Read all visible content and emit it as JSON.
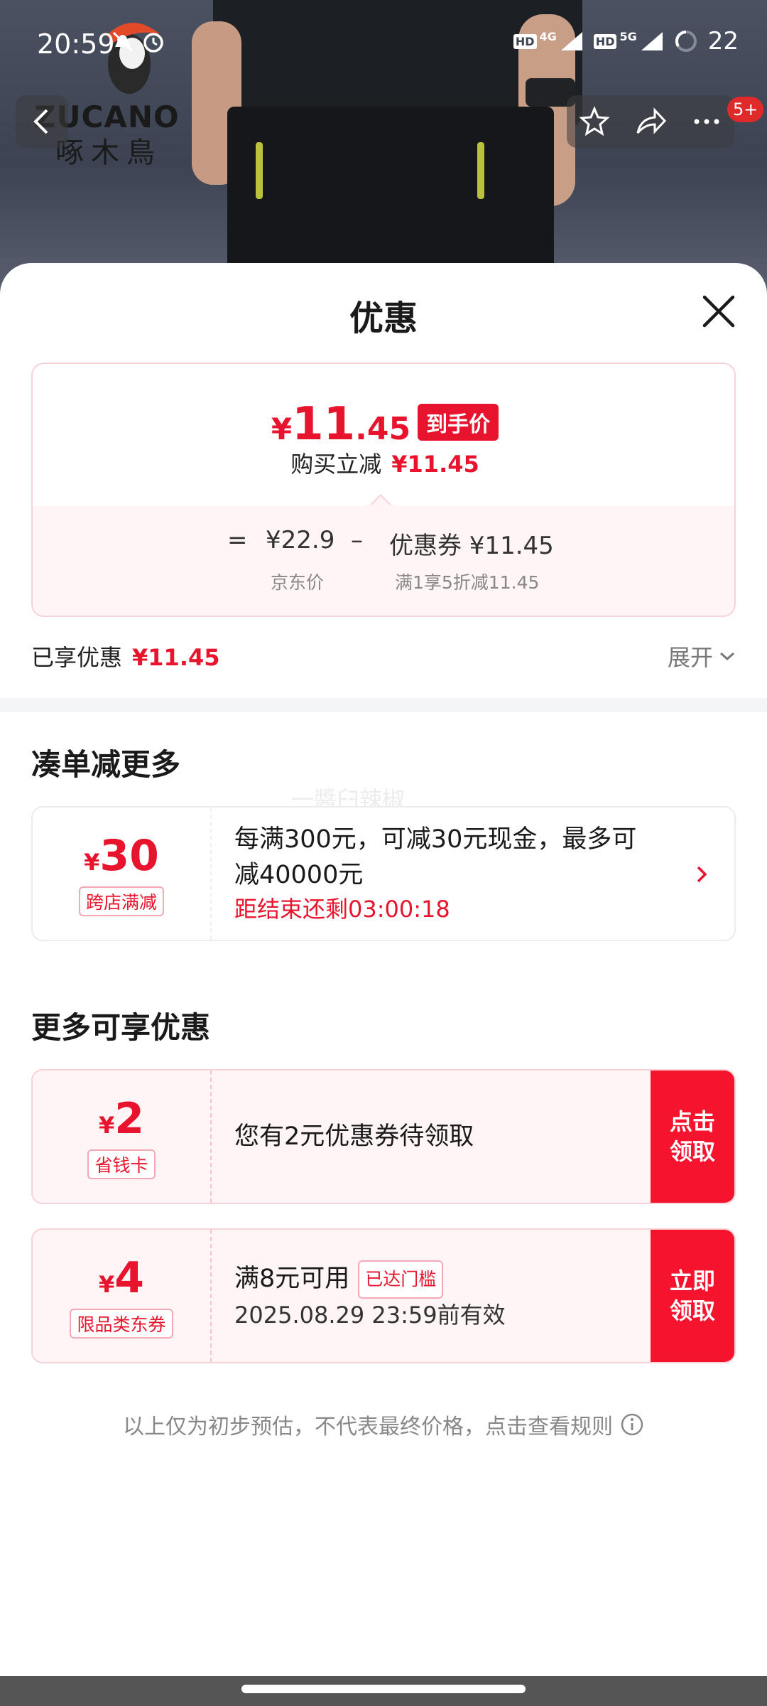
{
  "status_bar": {
    "time": "20:59",
    "network_1": "4G",
    "network_2": "5G",
    "hd_label": "HD",
    "battery": "22"
  },
  "brand": {
    "logo_text": "ZUCANO",
    "logo_cn": "啄木鳥"
  },
  "header": {
    "badge_count": "5+"
  },
  "sheet": {
    "title": "优惠"
  },
  "price_card": {
    "yen": "¥",
    "price_int": "11",
    "price_dec": ".45",
    "final_tag": "到手价",
    "reduce_label": "购买立减",
    "reduce_value": "¥11.45",
    "equals": "=",
    "jd_price": "¥22.9",
    "minus": "–",
    "coupon_label": "优惠券 ¥11.45",
    "jd_price_label": "京东价",
    "coupon_rule": "满1享5折减11.45"
  },
  "enjoyed": {
    "label": "已享优惠",
    "value": "¥11.45",
    "expand": "展开"
  },
  "section_more_order": {
    "title": "凑单减更多",
    "coupon": {
      "yen": "¥",
      "amount": "30",
      "tag": "跨店满减",
      "text_line1": "每满300元，可减30元现金，最多可",
      "text_line2": "减40000元",
      "countdown": "距结束还剩03:00:18"
    }
  },
  "section_more_discount": {
    "title": "更多可享优惠",
    "coupons": [
      {
        "yen": "¥",
        "amount": "2",
        "tag": "省钱卡",
        "text": "您有2元优惠券待领取",
        "btn_line1": "点击",
        "btn_line2": "领取"
      },
      {
        "yen": "¥",
        "amount": "4",
        "tag": "限品类东券",
        "text": "满8元可用",
        "reach_tag": "已达门槛",
        "valid": "2025.08.29 23:59前有效",
        "btn_line1": "立即",
        "btn_line2": "领取"
      }
    ]
  },
  "footer": {
    "note": "以上仅为初步预估，不代表最终价格，点击查看规则"
  },
  "watermark": "一醬臼辣椒",
  "colors": {
    "accent_red": "#e8142d",
    "button_red": "#f5132d",
    "card_pink": "#fff5f6",
    "card_border": "#f7d3d8"
  }
}
